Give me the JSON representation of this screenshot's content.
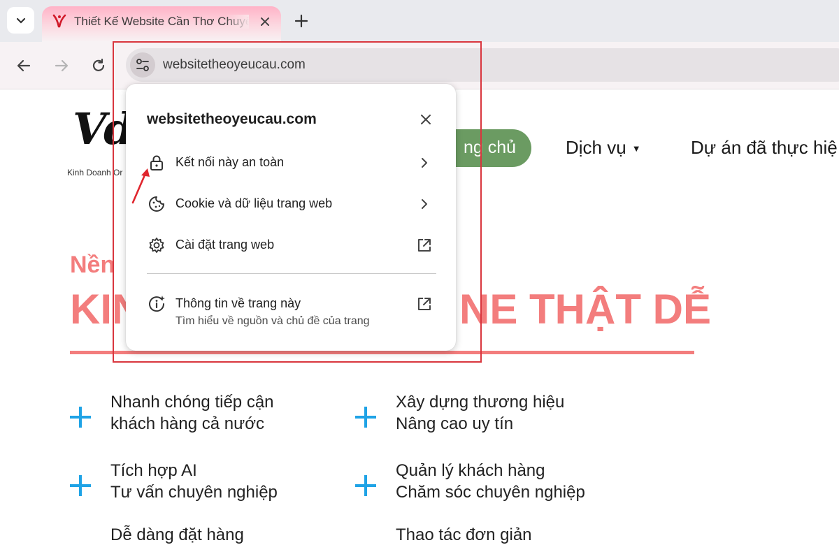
{
  "browser": {
    "tab": {
      "title": "Thiết Kế Website Cần Thơ Chuyên Nghiệp",
      "favicon": "vdesign-favicon-icon"
    },
    "url": "websitetheoyeucau.com",
    "icons": [
      "tab-search-icon",
      "close-icon",
      "plus-icon",
      "back-arrow-icon",
      "forward-arrow-icon",
      "reload-icon",
      "site-settings-icon"
    ]
  },
  "site": {
    "logo": "Vdes",
    "logo_sub": "Kinh Doanh Or",
    "nav": {
      "home_label": "ng chủ",
      "services": "Dịch vụ",
      "projects": "Dự án đã thực hiệ"
    },
    "hero": {
      "small": "Nền",
      "big_left": "KIN",
      "big_right": "NE THẬT DỄ"
    },
    "features": [
      {
        "line1": "Nhanh chóng tiếp cận",
        "line2": "khách hàng cả nước"
      },
      {
        "line1": "Xây dựng thương hiệu",
        "line2": "Nâng cao uy tín"
      },
      {
        "line1": "Tích hợp AI",
        "line2": "Tư vấn chuyên nghiệp"
      },
      {
        "line1": "Quản lý khách hàng",
        "line2": "Chăm sóc chuyên nghiệp"
      },
      {
        "line1": "Dễ dàng đặt hàng",
        "line2": ""
      },
      {
        "line1": "Thao tác đơn giản",
        "line2": ""
      }
    ],
    "colors": {
      "accent": "#f37d7d",
      "nav_green": "#6b9b62",
      "plus_blue": "#1fa3e6"
    }
  },
  "popup": {
    "title": "websitetheoyeucau.com",
    "items": [
      {
        "label": "Kết nối này an toàn",
        "icon": "lock-icon",
        "right": "chevron-right-icon"
      },
      {
        "label": "Cookie và dữ liệu trang web",
        "icon": "cookie-icon",
        "right": "chevron-right-icon"
      },
      {
        "label": "Cài đặt trang web",
        "icon": "gear-icon",
        "right": "external-link-icon"
      },
      {
        "label": "Thông tin về trang này",
        "sub": "Tìm hiểu về nguồn và chủ đề của trang",
        "icon": "page-info-icon",
        "right": "external-link-icon"
      }
    ]
  },
  "annotation": {
    "box_color": "#d9363e",
    "arrow": "red-arrow"
  }
}
